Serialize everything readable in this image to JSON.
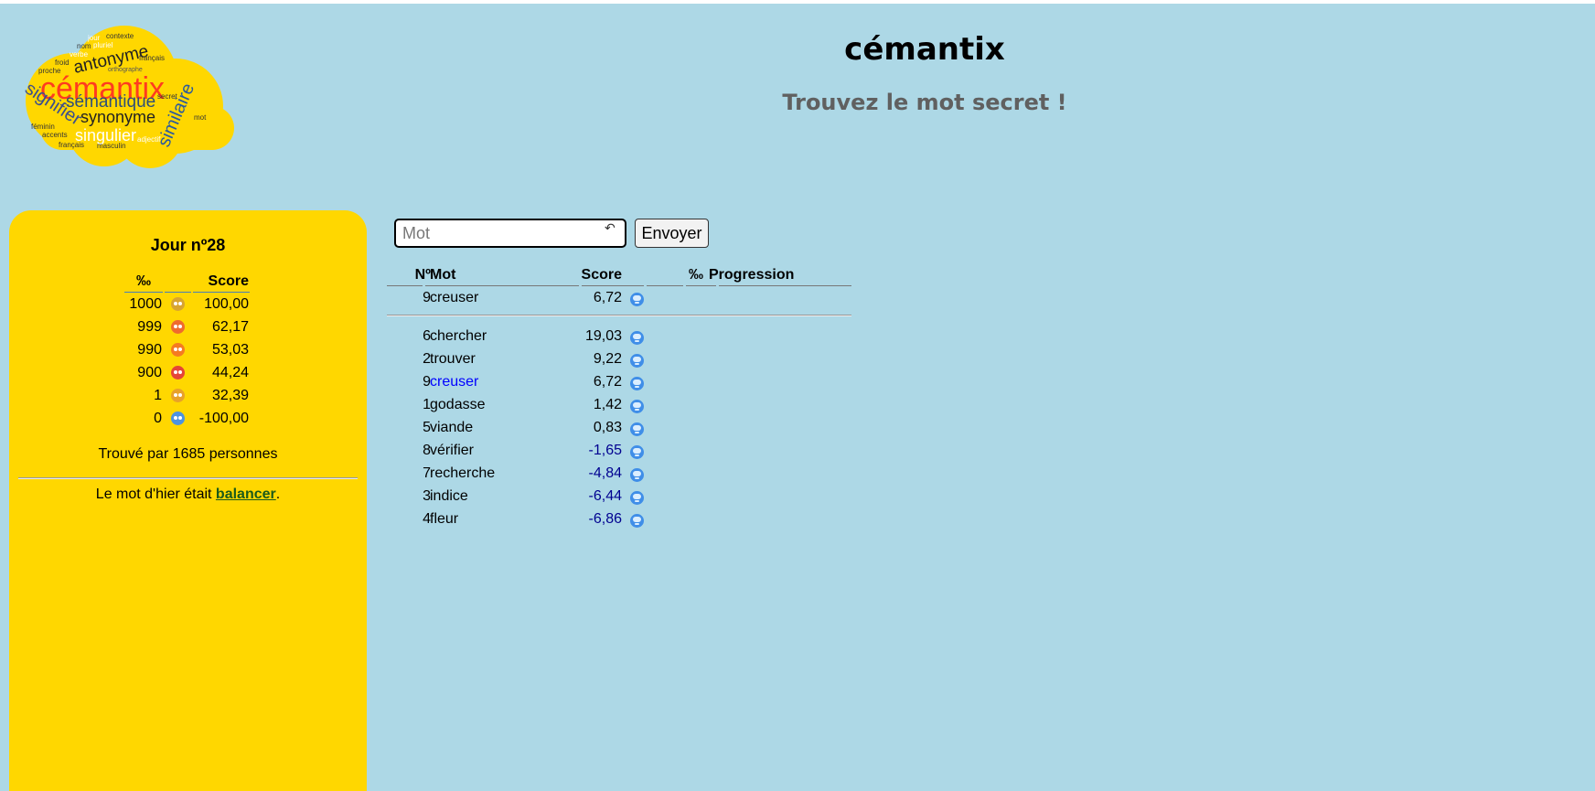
{
  "header": {
    "title": "cémantix",
    "subtitle": "Trouvez le mot secret !"
  },
  "logo": {
    "words": [
      "jour",
      "contexte",
      "nom",
      "pluriel",
      "antonyme",
      "verbe",
      "français",
      "froid",
      "orthographe",
      "proche",
      "cémantix",
      "signifier",
      "sémantique",
      "secret",
      "similaire",
      "synonyme",
      "mot",
      "féminin",
      "singulier",
      "accents",
      "adjectif",
      "français",
      "masculin"
    ],
    "background_color": "#FFD700",
    "main_word_color": "#FF3B1F"
  },
  "side_panel": {
    "day_title": "Jour nº28",
    "scale": {
      "headers": {
        "permil": "‰",
        "emoji": "",
        "score": "Score"
      },
      "rows": [
        {
          "permil": "1000",
          "icon": "confetti-icon",
          "color": "#d8a430",
          "score": "100,00"
        },
        {
          "permil": "999",
          "icon": "screaming-face-icon",
          "color": "#ef6a2e",
          "score": "62,17"
        },
        {
          "permil": "990",
          "icon": "fire-icon",
          "color": "#f57b21",
          "score": "53,03"
        },
        {
          "permil": "900",
          "icon": "santa-face-icon",
          "color": "#e54438",
          "score": "44,24"
        },
        {
          "permil": "1",
          "icon": "sunglasses-face-icon",
          "color": "#e8a12a",
          "score": "32,39"
        },
        {
          "permil": "0",
          "icon": "cold-face-icon",
          "color": "#4d93e0",
          "score": "-100,00"
        }
      ]
    },
    "found_text": "Trouvé par 1685 personnes",
    "yesterday_prefix": "Le mot d'hier était ",
    "yesterday_word": "balancer",
    "yesterday_suffix": "."
  },
  "form": {
    "input_placeholder": "Mot",
    "input_value": "",
    "send_label": "Envoyer"
  },
  "guesses": {
    "headers": {
      "num": "Nº",
      "word": "Mot",
      "score": "Score",
      "emoji": "",
      "permil": "‰",
      "progress": "Progression"
    },
    "latest": {
      "num": "9",
      "word": "creuser",
      "score": "6,72",
      "icon": "cold-face-icon"
    },
    "rows": [
      {
        "num": "6",
        "word": "chercher",
        "score": "19,03",
        "icon": "cold-face-icon"
      },
      {
        "num": "2",
        "word": "trouver",
        "score": "9,22",
        "icon": "cold-face-icon"
      },
      {
        "num": "9",
        "word": "creuser",
        "score": "6,72",
        "icon": "cold-face-icon"
      },
      {
        "num": "1",
        "word": "godasse",
        "score": "1,42",
        "icon": "cold-face-icon"
      },
      {
        "num": "5",
        "word": "viande",
        "score": "0,83",
        "icon": "cold-face-icon"
      },
      {
        "num": "8",
        "word": "vérifier",
        "score": "-1,65",
        "icon": "cold-face-icon"
      },
      {
        "num": "7",
        "word": "recherche",
        "score": "-4,84",
        "icon": "cold-face-icon"
      },
      {
        "num": "3",
        "word": "indice",
        "score": "-6,44",
        "icon": "cold-face-icon"
      },
      {
        "num": "4",
        "word": "fleur",
        "score": "-6,86",
        "icon": "cold-face-icon"
      }
    ]
  }
}
